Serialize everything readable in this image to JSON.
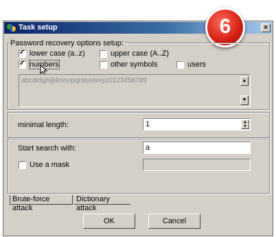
{
  "window": {
    "title": "Task setup",
    "close_glyph": "×"
  },
  "step_badge": "6",
  "options_group": {
    "label": "Password recovery options setup:",
    "checkboxes": [
      {
        "label": "lower case (a..z)",
        "checked": true
      },
      {
        "label": "upper case (A..Z)",
        "checked": false
      },
      {
        "label": "numbers",
        "checked": true
      },
      {
        "label": "other symbols",
        "checked": false
      },
      {
        "label": "users",
        "checked": false
      }
    ],
    "charset_preview": "abcdefghijklmnopqrstuvwxyz0123456789"
  },
  "minimal_length": {
    "label": "minimal length:",
    "value": "1"
  },
  "search": {
    "label": "Start search with:",
    "value": "a"
  },
  "mask": {
    "label": "Use a mask",
    "checked": false,
    "value": ""
  },
  "tabs": [
    {
      "label": "Brute-force attack",
      "active": true
    },
    {
      "label": "Dictionary attack",
      "active": false
    }
  ],
  "buttons": {
    "ok": "OK",
    "cancel": "Cancel"
  },
  "icons": {
    "title": "app-icon",
    "cursor": "mouse-pointer-icon"
  },
  "colors": {
    "titlebar": "#0a246a",
    "badge": "#d61d10",
    "face": "#d4d0c8"
  }
}
